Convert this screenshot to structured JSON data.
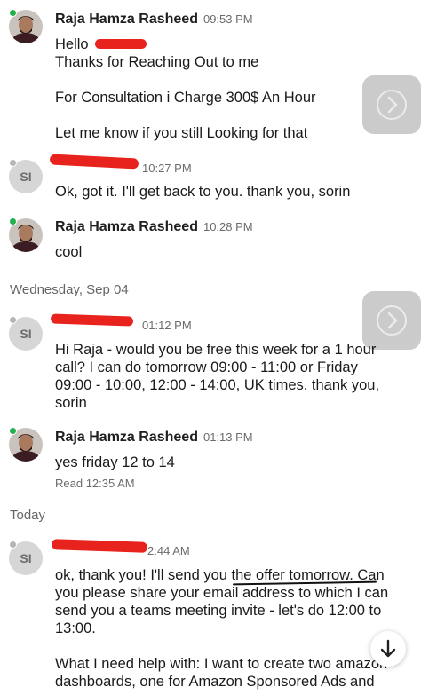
{
  "messages": [
    {
      "sender": "Raja Hamza Rasheed",
      "time": "09:53 PM",
      "lines": [
        "Hello",
        "Thanks for Reaching Out to me",
        "",
        "For Consultation i Charge 300$ An Hour",
        "",
        "Let me know if you still Looking for that"
      ]
    },
    {
      "initials": "SI",
      "time": "10:27 PM",
      "lines": [
        "Ok, got it. I'll get back to you. thank you, sorin"
      ]
    },
    {
      "sender": "Raja Hamza Rasheed",
      "time": "10:28 PM",
      "lines": [
        "cool"
      ]
    },
    {
      "initials": "SI",
      "time": "01:12 PM",
      "lines": [
        "Hi Raja - would you be free this week for a 1 hour",
        "call? I can do tomorrow 09:00 - 11:00 or Friday",
        "09:00 - 10:00, 12:00 - 14:00, UK times. thank you,",
        "sorin"
      ]
    },
    {
      "sender": "Raja Hamza Rasheed",
      "time": "01:13 PM",
      "lines": [
        "yes friday 12 to 14"
      ],
      "read_receipt": "Read 12:35 AM"
    },
    {
      "initials": "SI",
      "time": "2:44 AM",
      "lines": [
        "ok, thank you! I'll send you the offer tomorrow. Can",
        "you please share your email address to which I can",
        "send you a teams meeting invite - let's do 12:00 to",
        "13:00.",
        "",
        "What I need help with: I want to create two amazon",
        "dashboards, one for Amazon Sponsored Ads and"
      ]
    }
  ],
  "day_separators": [
    "Wednesday, Sep 04",
    "Today"
  ],
  "icons": [
    "chevron-right-icon",
    "arrow-down-icon"
  ],
  "colors": {
    "redaction": "#e8231e",
    "online": "#22b04a",
    "muted": "#6b6b6b"
  }
}
